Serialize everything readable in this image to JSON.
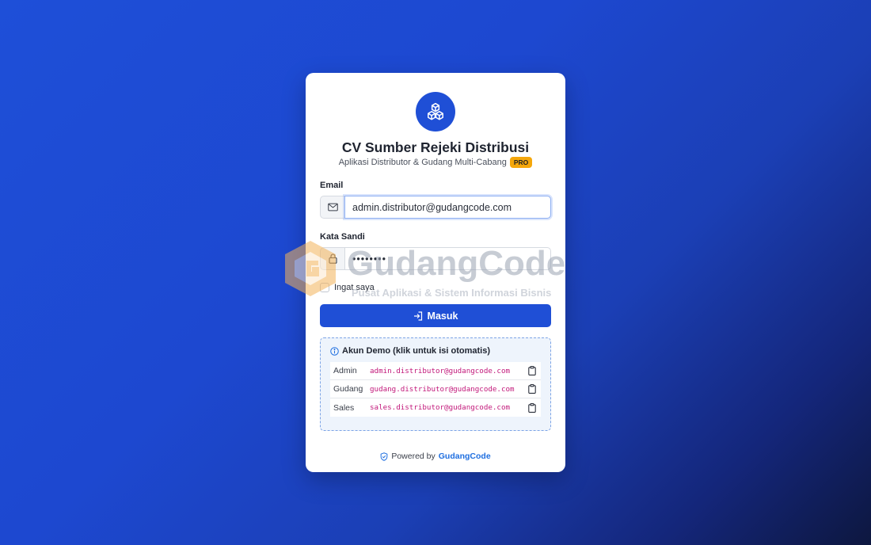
{
  "brand": {
    "company": "CV Sumber Rejeki Distribusi",
    "subtitle": "Aplikasi Distributor & Gudang Multi-Cabang",
    "badge": "PRO",
    "logo_icon": "cubes-icon",
    "accent_color": "#1f4fd6"
  },
  "form": {
    "email_label": "Email",
    "email_value": "admin.distributor@gudangcode.com",
    "password_label": "Kata Sandi",
    "password_mask": "••••••••",
    "remember_label": "Ingat saya",
    "submit_label": "Masuk"
  },
  "demo": {
    "title": "Akun Demo (klik untuk isi otomatis)",
    "accounts": [
      {
        "role": "Admin",
        "email": "admin.distributor@gudangcode.com"
      },
      {
        "role": "Gudang",
        "email": "gudang.distributor@gudangcode.com"
      },
      {
        "role": "Sales",
        "email": "sales.distributor@gudangcode.com"
      }
    ]
  },
  "footer": {
    "prefix": "Powered by",
    "brand": "GudangCode"
  },
  "watermark": {
    "title": "GudangCode",
    "tagline": "Pusat Aplikasi & Sistem Informasi Bisnis"
  }
}
